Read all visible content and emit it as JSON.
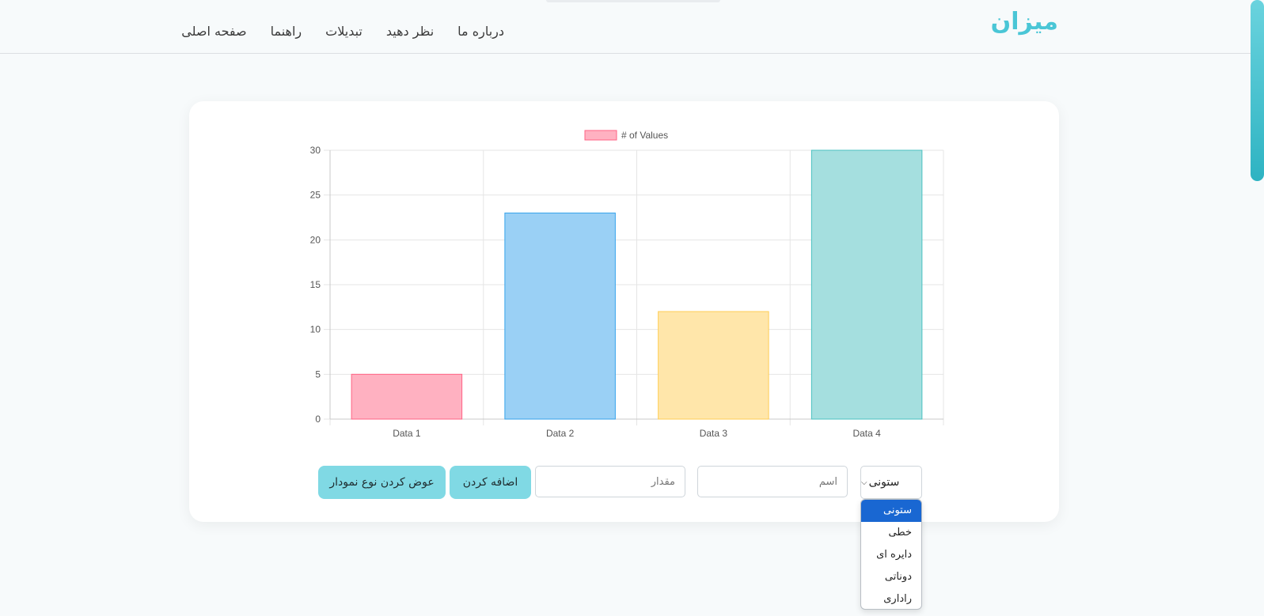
{
  "brand": "میزان",
  "nav": {
    "items": [
      "صفحه اصلی",
      "راهنما",
      "تبدیلات",
      "نظر دهید",
      "درباره ما"
    ]
  },
  "controls": {
    "chart_type_selected": "ستونی",
    "name_placeholder": "اسم",
    "value_placeholder": "مقدار",
    "add_button": "اضافه کردن",
    "change_type_button": "عوض کردن نوع نمودار"
  },
  "dropdown": {
    "options": [
      "ستونی",
      "خطی",
      "دایره ای",
      "دوناتی",
      "راداری"
    ],
    "selected_index": 0
  },
  "colors": {
    "accent": "#4ac6d6",
    "button": "#80d9e4",
    "dropdown_selected": "#1967d2"
  },
  "chart_data": {
    "type": "bar",
    "categories": [
      "Data 1",
      "Data 2",
      "Data 3",
      "Data 4"
    ],
    "series": [
      {
        "name": "# of Values",
        "values": [
          5,
          23,
          12,
          30
        ]
      }
    ],
    "bar_fills": [
      "#ffb1c1",
      "#9ad0f5",
      "#ffe6aa",
      "#a5dfdf"
    ],
    "bar_strokes": [
      "#ff6384",
      "#36a2eb",
      "#ffcd56",
      "#4bc0c0"
    ],
    "ylim": [
      0,
      30
    ],
    "yticks": [
      0,
      5,
      10,
      15,
      20,
      25,
      30
    ],
    "grid": true,
    "legend": "top"
  }
}
